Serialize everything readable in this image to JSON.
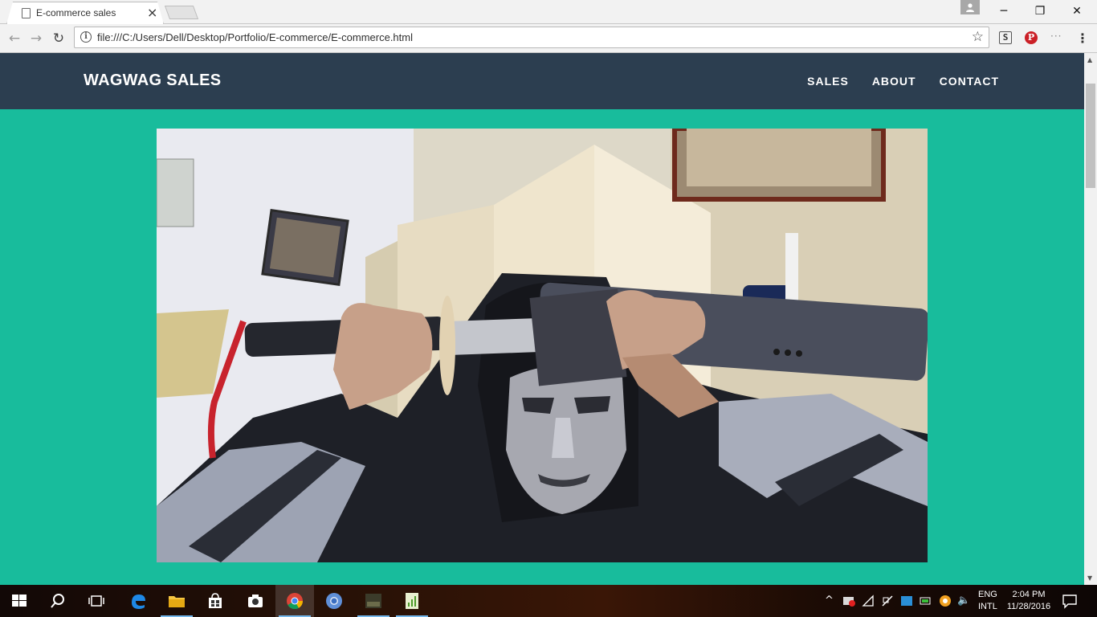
{
  "browser": {
    "tab_title": "E-commerce sales",
    "tab_close": "×",
    "url": "file:///C:/Users/Dell/Desktop/Portfolio/E-commerce/E-commerce.html",
    "window_minimize": "─",
    "window_maximize": "❐",
    "window_close": "✕",
    "back": "←",
    "forward": "→",
    "reload": "↻",
    "info": "i",
    "star": "☆",
    "ext_s": "S",
    "ext_p": "P",
    "ext_more": "···",
    "menu": "⋮"
  },
  "site": {
    "brand": "WAGWAG SALES",
    "nav": [
      {
        "label": "SALES"
      },
      {
        "label": "ABOUT"
      },
      {
        "label": "CONTACT"
      }
    ],
    "hero_alt": "Masked person holding a sword",
    "bg_color": "#18bc9c",
    "nav_color": "#2c3e50"
  },
  "taskbar": {
    "lang_line1": "ENG",
    "lang_line2": "INTL",
    "time": "2:04 PM",
    "date": "11/28/2016",
    "tray_chevron": "^",
    "tray_volume": "🔈"
  }
}
